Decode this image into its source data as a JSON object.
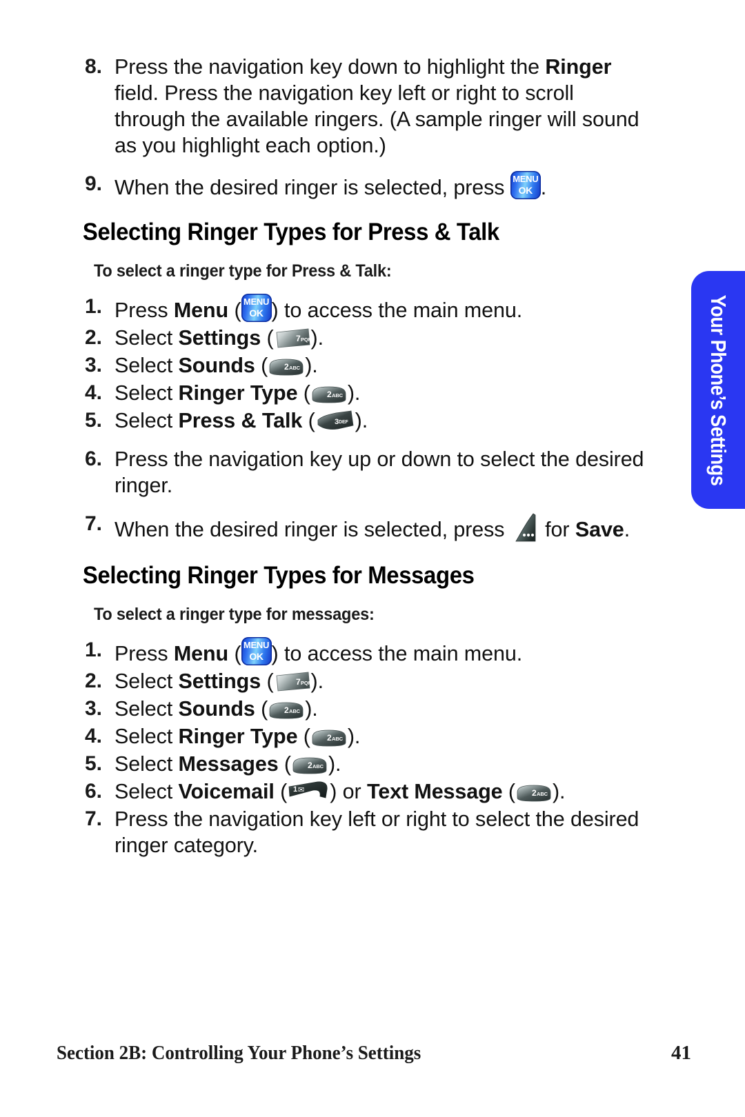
{
  "page": {
    "number": "41",
    "footer_title": "Section 2B: Controlling Your Phone’s Settings"
  },
  "side_tab": {
    "label": "Your Phone’s Settings",
    "color": "#2a37f2",
    "text_color": "#ffffff"
  },
  "continued_list": {
    "items": [
      {
        "number": "8.",
        "text_1": "Press the navigation key down to highlight the ",
        "bold_1": "Ringer",
        "text_2": " field. Press the navigation key left or right to scroll through the available ringers. (A sample ringer will sound as you highlight each option.)"
      },
      {
        "number": "9.",
        "text_1": "When the desired ringer is selected, press ",
        "icon": "menu-ok-key",
        "text_2": "."
      }
    ]
  },
  "sections": [
    {
      "heading": "Selecting Ringer Types for Press & Talk",
      "subheading": "To select a ringer type for Press & Talk:",
      "steps": [
        {
          "number": "1.",
          "pre": "Press ",
          "bold": "Menu",
          "mid": " (",
          "icon": "menu-ok-key",
          "post": ") to access the main menu."
        },
        {
          "number": "2.",
          "pre": "Select ",
          "bold": "Settings",
          "mid": " (",
          "icon": "key-7-pqrs",
          "post": ")."
        },
        {
          "number": "3.",
          "pre": "Select ",
          "bold": "Sounds",
          "mid": " (",
          "icon": "key-2-abc",
          "post": ")."
        },
        {
          "number": "4.",
          "pre": "Select ",
          "bold": "Ringer Type",
          "mid": " (",
          "icon": "key-2-abc",
          "post": ")."
        },
        {
          "number": "5.",
          "pre": "Select ",
          "bold": "Press & Talk",
          "mid": " (",
          "icon": "key-3-def",
          "post": ")."
        },
        {
          "number": "6.",
          "pre": "Press the navigation key up or down to select the desired ringer."
        },
        {
          "number": "7.",
          "pre": "When the desired ringer is selected, press ",
          "icon": "softkey-left",
          "mid2": " for ",
          "bold2": "Save",
          "post": "."
        }
      ]
    },
    {
      "heading": "Selecting Ringer Types for Messages",
      "subheading": "To select a ringer type for messages:",
      "steps": [
        {
          "number": "1.",
          "pre": "Press ",
          "bold": "Menu",
          "mid": " (",
          "icon": "menu-ok-key",
          "post": ") to access the main menu."
        },
        {
          "number": "2.",
          "pre": "Select ",
          "bold": "Settings",
          "mid": " (",
          "icon": "key-7-pqrs",
          "post": ")."
        },
        {
          "number": "3.",
          "pre": "Select ",
          "bold": "Sounds",
          "mid": " (",
          "icon": "key-2-abc",
          "post": ")."
        },
        {
          "number": "4.",
          "pre": "Select ",
          "bold": "Ringer Type",
          "mid": " (",
          "icon": "key-2-abc",
          "post": ")."
        },
        {
          "number": "5.",
          "pre": "Select ",
          "bold": "Messages",
          "mid": " (",
          "icon": "key-2-abc",
          "post": ")."
        },
        {
          "number": "6.",
          "pre": "Select ",
          "bold": "Voicemail",
          "mid": " (",
          "icon": "key-1-voicemail",
          "mid2": ") or ",
          "bold2": "Text Message",
          "mid3": " (",
          "icon2": "key-2-abc",
          "post": ")."
        },
        {
          "number": "7.",
          "pre": "Press the navigation key left or right to select the desired ringer category."
        }
      ]
    }
  ],
  "key_labels": {
    "menu_line1": "MENU",
    "menu_line2": "OK",
    "key7_digit": "7",
    "key7_letters": "PQRS",
    "key2_digit": "2",
    "key2_letters": "ABC",
    "key3_digit": "3",
    "key3_letters": "DEF",
    "key1_digit": "1",
    "key1_glyph": "✉"
  }
}
